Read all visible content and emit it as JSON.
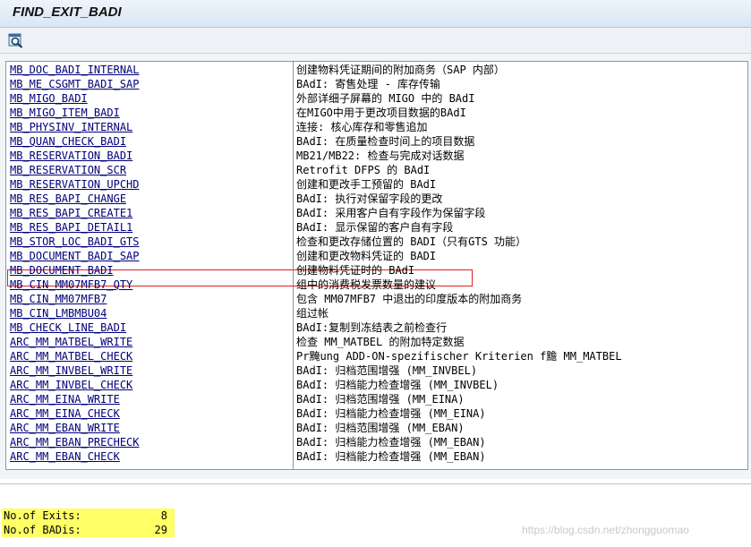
{
  "window": {
    "title": "FIND_EXIT_BADI"
  },
  "toolbar": {
    "find_icon": "find-icon"
  },
  "table": {
    "rows": [
      {
        "name": "MB_DOC_BADI_INTERNAL",
        "description": "创建物料凭证期间的附加商务（SAP 内部）"
      },
      {
        "name": "MB_ME_CSGMT_BADI_SAP",
        "description": "BAdI: 寄售处理 - 库存传输"
      },
      {
        "name": "MB_MIGO_BADI",
        "description": "外部详细子屏幕的 MIGO 中的 BAdI"
      },
      {
        "name": "MB_MIGO_ITEM_BADI",
        "description": "在MIGO中用于更改项目数据的BAdI"
      },
      {
        "name": "MB_PHYSINV_INTERNAL",
        "description": "连接: 核心库存和零售追加"
      },
      {
        "name": "MB_QUAN_CHECK_BADI",
        "description": "BAdI: 在质量检查时间上的项目数据"
      },
      {
        "name": "MB_RESERVATION_BADI",
        "description": "MB21/MB22: 检查与完成对话数据"
      },
      {
        "name": "MB_RESERVATION_SCR",
        "description": "Retrofit DFPS 的 BAdI"
      },
      {
        "name": "MB_RESERVATION_UPCHD",
        "description": "创建和更改手工预留的 BAdI"
      },
      {
        "name": "MB_RES_BAPI_CHANGE",
        "description": "BAdI: 执行对保留字段的更改"
      },
      {
        "name": "MB_RES_BAPI_CREATE1",
        "description": "BAdI: 采用客户自有字段作为保留字段"
      },
      {
        "name": "MB_RES_BAPI_DETAIL1",
        "description": "BAdI: 显示保留的客户自有字段"
      },
      {
        "name": "MB_STOR_LOC_BADI_GTS",
        "description": "检查和更改存储位置的 BADI（只有GTS 功能）"
      },
      {
        "name": "MB_DOCUMENT_BADI_SAP",
        "description": "创建和更改物料凭证的 BADI"
      },
      {
        "name": "MB_DOCUMENT_BADI",
        "description": "创建物料凭证时的 BAdI"
      },
      {
        "name": "MB_CIN_MM07MFB7_QTY",
        "description": "组中的消费税发票数量的建议"
      },
      {
        "name": "MB_CIN_MM07MFB7",
        "description": "包含 MM07MFB7 中退出的印度版本的附加商务"
      },
      {
        "name": "MB_CIN_LMBMBU04",
        "description": "组过帐"
      },
      {
        "name": "MB_CHECK_LINE_BADI",
        "description": "BAdI:复制到冻结表之前检查行"
      },
      {
        "name": "ARC_MM_MATBEL_WRITE",
        "description": "检查 MM_MATBEL 的附加特定数据"
      },
      {
        "name": "ARC_MM_MATBEL_CHECK",
        "description": "Pr黤ung ADD-ON-spezifischer Kriterien f黵 MM_MATBEL"
      },
      {
        "name": "ARC_MM_INVBEL_WRITE",
        "description": "BAdI: 归档范围增强 (MM_INVBEL)"
      },
      {
        "name": "ARC_MM_INVBEL_CHECK",
        "description": "BAdI: 归档能力检查增强 (MM_INVBEL)"
      },
      {
        "name": "ARC_MM_EINA_WRITE",
        "description": "BAdI: 归档范围增强 (MM_EINA)"
      },
      {
        "name": "ARC_MM_EINA_CHECK",
        "description": "BAdI: 归档能力检查增强 (MM_EINA)"
      },
      {
        "name": "ARC_MM_EBAN_WRITE",
        "description": "BAdI: 归档范围增强 (MM_EBAN)"
      },
      {
        "name": "ARC_MM_EBAN_PRECHECK",
        "description": "BAdI: 归档能力检查增强 (MM_EBAN)"
      },
      {
        "name": "ARC_MM_EBAN_CHECK",
        "description": "BAdI: 归档能力检查增强 (MM_EBAN)"
      }
    ],
    "highlighted_row": "MB_DOCUMENT_BADI"
  },
  "summary": {
    "exits_label": "No.of Exits:",
    "exits_value": "8",
    "badis_label": "No.of BADis:",
    "badis_value": "29"
  },
  "watermark": "https://blog.csdn.net/zhongguomao",
  "colors": {
    "link": "#00007a",
    "highlight_border": "#e02020",
    "summary_background": "#ffff66"
  }
}
